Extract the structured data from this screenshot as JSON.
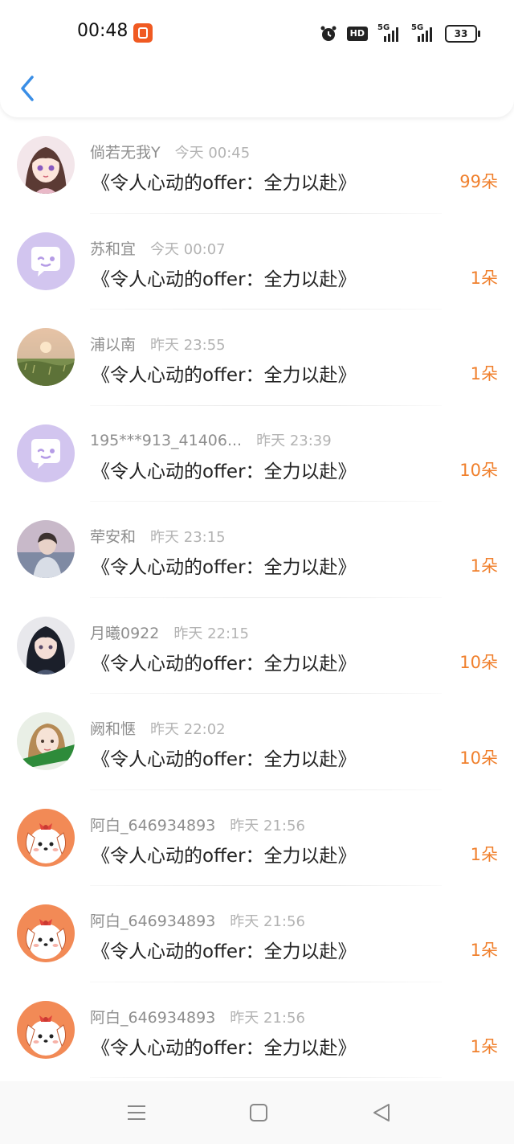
{
  "status_bar": {
    "time": "00:48",
    "app_icon": "video-app-icon",
    "icons": [
      "alarm-icon",
      "hd-icon",
      "signal-5g-icon",
      "signal-5g-icon"
    ],
    "hd_label": "HD",
    "net_label": "5G",
    "battery": "33"
  },
  "header": {
    "back_icon": "chevron-left-icon",
    "accent": "#3a8ee6"
  },
  "colors": {
    "amount": "#f0802d",
    "name": "#8e8e8e",
    "time": "#b3b3b3"
  },
  "rows": [
    {
      "name": "倘若无我Y",
      "time": "今天 00:45",
      "program": "《令人心动的offer：全力以赴》",
      "amount": "99朵",
      "avatar": "anime-girl-avatar"
    },
    {
      "name": "苏和宜",
      "time": "今天 00:07",
      "program": "《令人心动的offer：全力以赴》",
      "amount": "1朵",
      "avatar": "default-chat-avatar"
    },
    {
      "name": "浦以南",
      "time": "昨天 23:55",
      "program": "《令人心动的offer：全力以赴》",
      "amount": "1朵",
      "avatar": "landscape-avatar"
    },
    {
      "name": "195***913_41406...",
      "time": "昨天 23:39",
      "program": "《令人心动的offer：全力以赴》",
      "amount": "10朵",
      "avatar": "default-chat-avatar"
    },
    {
      "name": "荦安和",
      "time": "昨天 23:15",
      "program": "《令人心动的offer：全力以赴》",
      "amount": "1朵",
      "avatar": "person-photo-avatar"
    },
    {
      "name": "月曦0922",
      "time": "昨天 22:15",
      "program": "《令人心动的offer：全力以赴》",
      "amount": "10朵",
      "avatar": "dark-hair-girl-avatar"
    },
    {
      "name": "阙和惬",
      "time": "昨天 22:02",
      "program": "《令人心动的offer：全力以赴》",
      "amount": "10朵",
      "avatar": "girl-photo-avatar"
    },
    {
      "name": "阿白_646934893",
      "time": "昨天 21:56",
      "program": "《令人心动的offer：全力以赴》",
      "amount": "1朵",
      "avatar": "cartoon-dog-avatar"
    },
    {
      "name": "阿白_646934893",
      "time": "昨天 21:56",
      "program": "《令人心动的offer：全力以赴》",
      "amount": "1朵",
      "avatar": "cartoon-dog-avatar"
    },
    {
      "name": "阿白_646934893",
      "time": "昨天 21:56",
      "program": "《令人心动的offer：全力以赴》",
      "amount": "1朵",
      "avatar": "cartoon-dog-avatar"
    }
  ],
  "nav_bar": {
    "icons": [
      "menu-icon",
      "home-square-icon",
      "back-triangle-icon"
    ]
  }
}
